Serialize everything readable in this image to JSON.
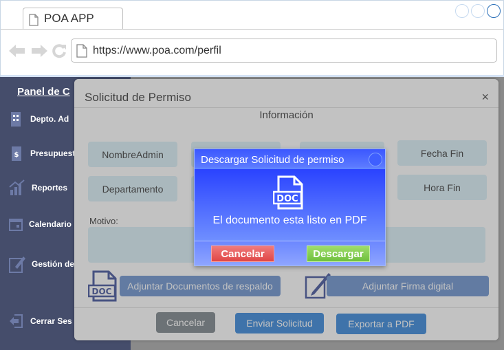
{
  "browser": {
    "tab_title": "POA APP",
    "url": "https://www.poa.com/perfil"
  },
  "sidebar": {
    "title": "Panel de C",
    "items": [
      {
        "label": "Depto. Ad",
        "icon": "building-icon"
      },
      {
        "label": "Presupuest",
        "icon": "budget-icon"
      },
      {
        "label": "Reportes",
        "icon": "chart-icon"
      },
      {
        "label": "Calendario",
        "icon": "calendar-icon"
      },
      {
        "label": "Gestión de",
        "icon": "edit-icon"
      },
      {
        "label": "Cerrar Ses",
        "icon": "logout-icon"
      }
    ]
  },
  "modal": {
    "title": "Solicitud de Permiso",
    "close": "×",
    "section_heading": "Información",
    "fields": {
      "nombre_admin": "NombreAdmin",
      "departamento": "Departamento",
      "fecha_fin": "Fecha Fin",
      "hora_fin": "Hora Fin"
    },
    "motivo_label": "Motivo:",
    "attach_docs": "Adjuntar Documentos de respaldo",
    "attach_signature": "Adjuntar Firma digital",
    "doc_icon_text": "DOC",
    "buttons": {
      "cancel": "Cancelar",
      "send": "Enviar Solicitud",
      "export": "Exportar a PDF"
    }
  },
  "dialog": {
    "title": "Descargar Solicitud de permiso",
    "doc_icon_text": "DOC",
    "message": "El documento esta listo en PDF",
    "cancel": "Cancelar",
    "download": "Descargar"
  }
}
